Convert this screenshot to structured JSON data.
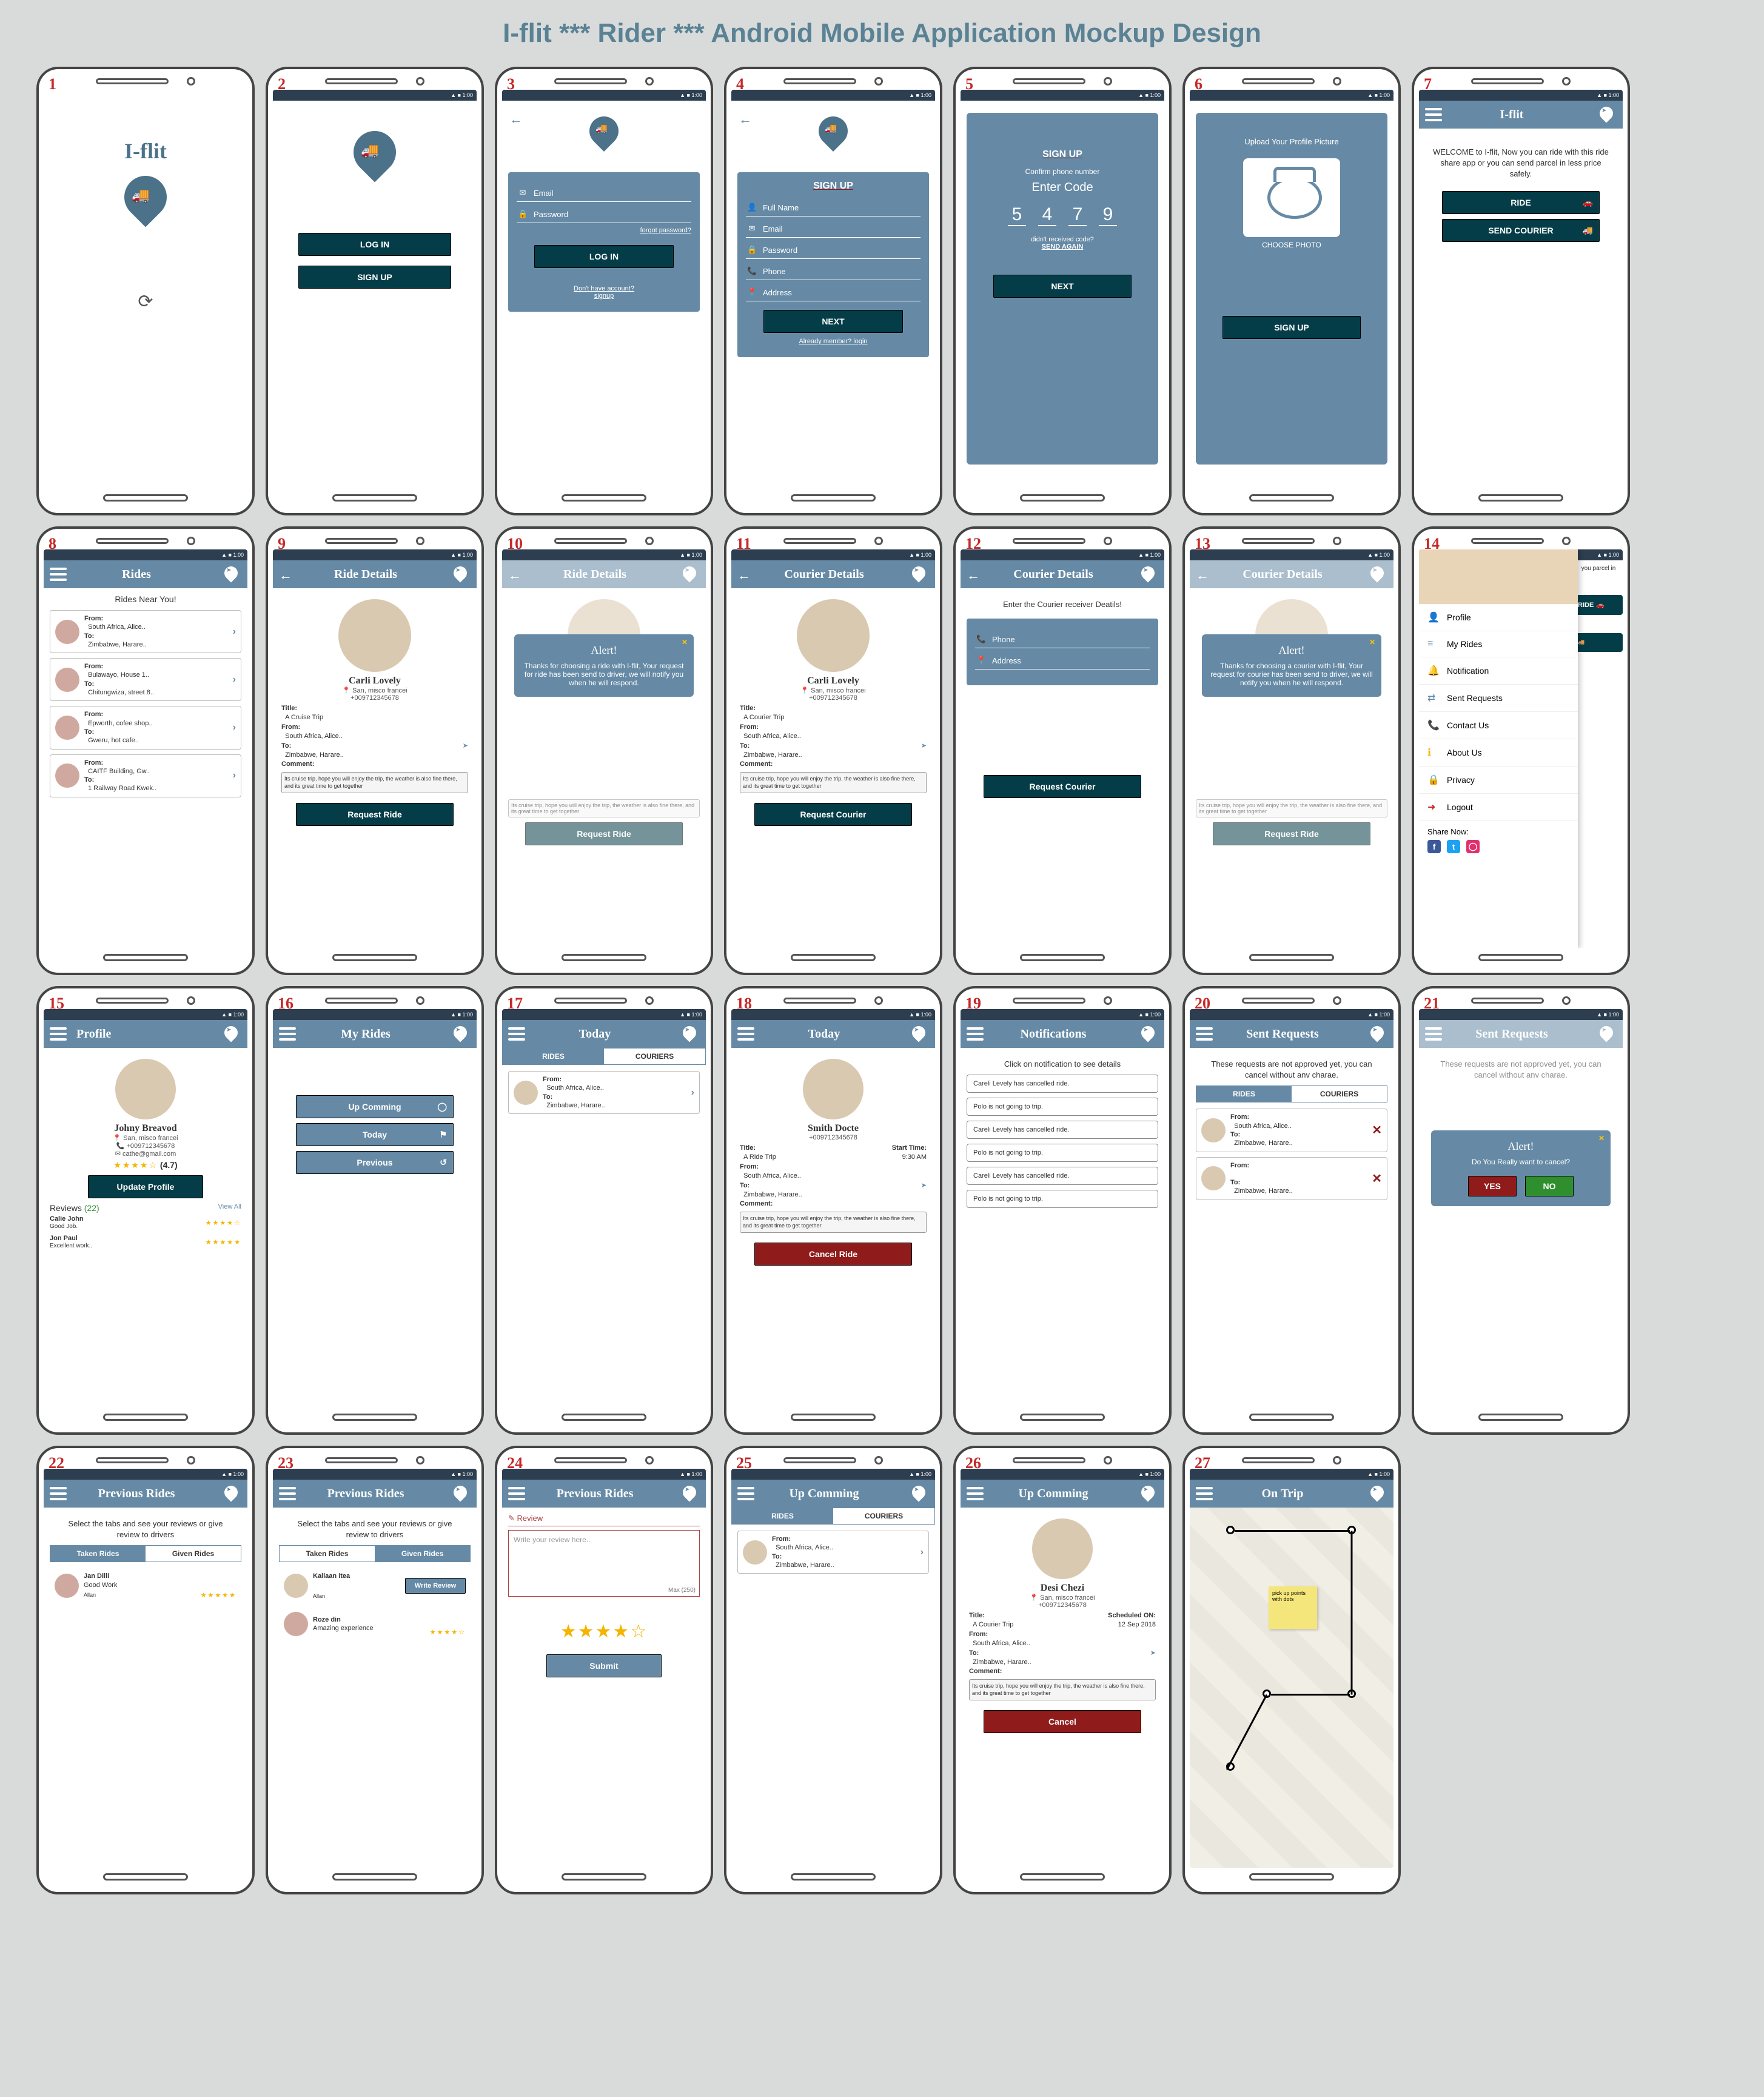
{
  "page_title": "I-flit *** Rider ***  Android Mobile Application Mockup Design",
  "brand": "I-flit",
  "colors": {
    "primary": "#668aa5",
    "dark": "#043d48",
    "red": "#8f1b1b",
    "green": "#2f8f2f"
  },
  "s1": {
    "brand": "I-flit"
  },
  "s2": {
    "login": "LOG IN",
    "signup": "SIGN UP"
  },
  "s3": {
    "email": "Email",
    "password": "Password",
    "forgot": "forgot password?",
    "login": "LOG IN",
    "noacct": "Don't have account?",
    "signup": "signup"
  },
  "s4": {
    "title": "SIGN UP",
    "fullname": "Full Name",
    "email": "Email",
    "password": "Password",
    "phone": "Phone",
    "address": "Address",
    "next": "NEXT",
    "already": "Already member? login"
  },
  "s5": {
    "title": "SIGN UP",
    "confirm": "Confirm phone number",
    "enter": "Enter Code",
    "d1": "5",
    "d2": "4",
    "d3": "7",
    "d4": "9",
    "notrecv": "didn't received code?",
    "sendagain": "SEND AGAIN",
    "next": "NEXT"
  },
  "s6": {
    "upload": "Upload Your Profile Picture",
    "choose": "CHOOSE PHOTO",
    "signup": "SIGN UP"
  },
  "s7": {
    "title": "I-flit",
    "welcome": "WELCOME to I-flit, Now you can ride with this ride share app or you can send parcel in less price safely.",
    "ride": "RIDE",
    "send": "SEND COURIER"
  },
  "s8": {
    "title": "Rides",
    "near": "Rides Near You!",
    "items": [
      {
        "from": "South Africa, Alice..",
        "to": "Zimbabwe, Harare.."
      },
      {
        "from": "Bulawayo, House 1..",
        "to": "Chitungwiza, street 8.."
      },
      {
        "from": "Epworth, cofee shop..",
        "to": "Gweru, hot cafe.."
      },
      {
        "from": "CAITF Building, Gw..",
        "to": "1 Railway Road Kwek.."
      }
    ]
  },
  "s9": {
    "title": "Ride Details",
    "name": "Carli Lovely",
    "loc": "San, misco francei",
    "phone": "+009712345678",
    "t_title": "Title:",
    "t_val": "A Cruise Trip",
    "from": "South Africa, Alice..",
    "to": "Zimbabwe, Harare..",
    "c_label": "Comment:",
    "comment": "Its cruise trip, hope you will enjoy the trip, the weather is also fine there, and its great time to get together",
    "btn": "Request Ride"
  },
  "s10": {
    "title": "Ride Details",
    "alert_title": "Alert!",
    "alert_body": "Thanks for choosing a ride with I-flit, Your request for ride has been send to driver, we will notify you when he will respond.",
    "btn": "Request Ride"
  },
  "s11": {
    "title": "Courier Details",
    "name": "Carli Lovely",
    "loc": "San, misco francei",
    "phone": "+009712345678",
    "t_title": "Title:",
    "t_val": "A Courier Trip",
    "from": "South Africa, Alice..",
    "to": "Zimbabwe, Harare..",
    "c_label": "Comment:",
    "comment": "Its cruise trip, hope you will enjoy the trip, the weather is also fine there, and its great time to get together",
    "btn": "Request Courier"
  },
  "s12": {
    "title": "Courier Details",
    "enter": "Enter the Courier receiver Deatils!",
    "phone": "Phone",
    "address": "Address",
    "btn": "Request Courier"
  },
  "s13": {
    "title": "Courier Details",
    "alert_title": "Alert!",
    "alert_body": "Thanks for choosing a courier with I-flit, Your request for courier has been send to driver, we will notify you when he will respond.",
    "btn": "Request Ride"
  },
  "s14": {
    "items": [
      "Profile",
      "My Rides",
      "Notification",
      "Sent Requests",
      "Contact Us",
      "About Us",
      "Privacy",
      "Logout"
    ],
    "share": "Share Now:",
    "side_text": "you parcel in",
    "ride": "RIDE",
    "send": "SEND COURIER"
  },
  "s15": {
    "title": "Profile",
    "name": "Johny Breavod",
    "loc": "San, misco francei",
    "phone": "+009712345678",
    "email": "cathe@gmail.com",
    "stars": "★★★★☆",
    "score": "(4.7)",
    "update": "Update Profile",
    "reviews": "Reviews",
    "rcount": "(22)",
    "viewall": "View All",
    "r1_name": "Calie John",
    "r1_text": "Good Job.",
    "r1_stars": "★★★★☆",
    "r2_name": "Jon Paul",
    "r2_text": "Excellent work..",
    "r2_stars": "★★★★★"
  },
  "s16": {
    "title": "My Rides",
    "up": "Up Comming",
    "today": "Today",
    "prev": "Previous"
  },
  "s17": {
    "title": "Today",
    "tab1": "RIDES",
    "tab2": "COURIERS",
    "from": "South Africa, Alice..",
    "to": "Zimbabwe, Harare.."
  },
  "s18": {
    "title": "Today",
    "name": "Smith Docte",
    "phone": "+009712345678",
    "t_title": "Title:",
    "t_val": "A Ride Trip",
    "st_title": "Start Time:",
    "st_val": "9:30 AM",
    "from": "South Africa, Alice..",
    "to": "Zimbabwe, Harare..",
    "c_label": "Comment:",
    "comment": "Its cruise trip, hope you will enjoy the trip, the weather is also fine there, and its great time to get together",
    "btn": "Cancel Ride"
  },
  "s19": {
    "title": "Notifications",
    "sub": "Click on notification to see details",
    "items": [
      "Careli Levely has cancelled ride.",
      "Polo is not going to trip.",
      "Careli Levely has cancelled ride.",
      "Polo is not going to trip.",
      "Careli Levely has cancelled ride.",
      "Polo is not going to trip."
    ]
  },
  "s20": {
    "title": "Sent Requests",
    "sub": "These requests are not approved yet, you can cancel without anv charae.",
    "tab1": "RIDES",
    "tab2": "COURIERS",
    "items": [
      {
        "from": "South Africa, Alice..",
        "to": "Zimbabwe, Harare.."
      },
      {
        "from": "",
        "to": "Zimbabwe, Harare.."
      }
    ]
  },
  "s21": {
    "title": "Sent Requests",
    "sub": "These requests are not approved yet, you can cancel without anv charae.",
    "alert_title": "Alert!",
    "alert_body": "Do You Really want to cancel?",
    "yes": "YES",
    "no": "NO"
  },
  "s22": {
    "title": "Previous Rides",
    "sub": "Select the tabs and see your reviews or give review to drivers",
    "tab1": "Taken Rides",
    "tab2": "Given Rides",
    "name": "Jan Dilli",
    "text": "Good Work",
    "by": "Allan",
    "stars": "★★★★★"
  },
  "s23": {
    "title": "Previous Rides",
    "sub": "Select the tabs and see your reviews or give review to drivers",
    "tab1": "Taken Rides",
    "tab2": "Given Rides",
    "r1_name": "Kallaan itea",
    "r1_by": "Allan",
    "btn": "Write Review",
    "r2_name": "Roze din",
    "r2_text": "Amazing experience",
    "r2_stars": "★★★★☆"
  },
  "s24": {
    "title": "Previous Rides",
    "review": "Review",
    "placeholder": "Write your review here..",
    "max": "Max (250)",
    "stars": "★★★★☆",
    "submit": "Submit"
  },
  "s25": {
    "title": "Up Comming",
    "tab1": "RIDES",
    "tab2": "COURIERS",
    "from": "South Africa, Alice..",
    "to": "Zimbabwe, Harare.."
  },
  "s26": {
    "title": "Up Comming",
    "name": "Desi Chezi",
    "loc": "San, misco francei",
    "phone": "+009712345678",
    "t_title": "Title:",
    "t_val": "A Courier Trip",
    "sch_title": "Scheduled ON:",
    "sch_val": "12 Sep 2018",
    "from": "South Africa, Alice..",
    "to": "Zimbabwe, Harare..",
    "c_label": "Comment:",
    "comment": "Its cruise trip, hope you will enjoy the trip, the weather is also fine there, and its great time to get together",
    "btn": "Cancel"
  },
  "s27": {
    "title": "On Trip",
    "postit": "pick up points with dots"
  }
}
